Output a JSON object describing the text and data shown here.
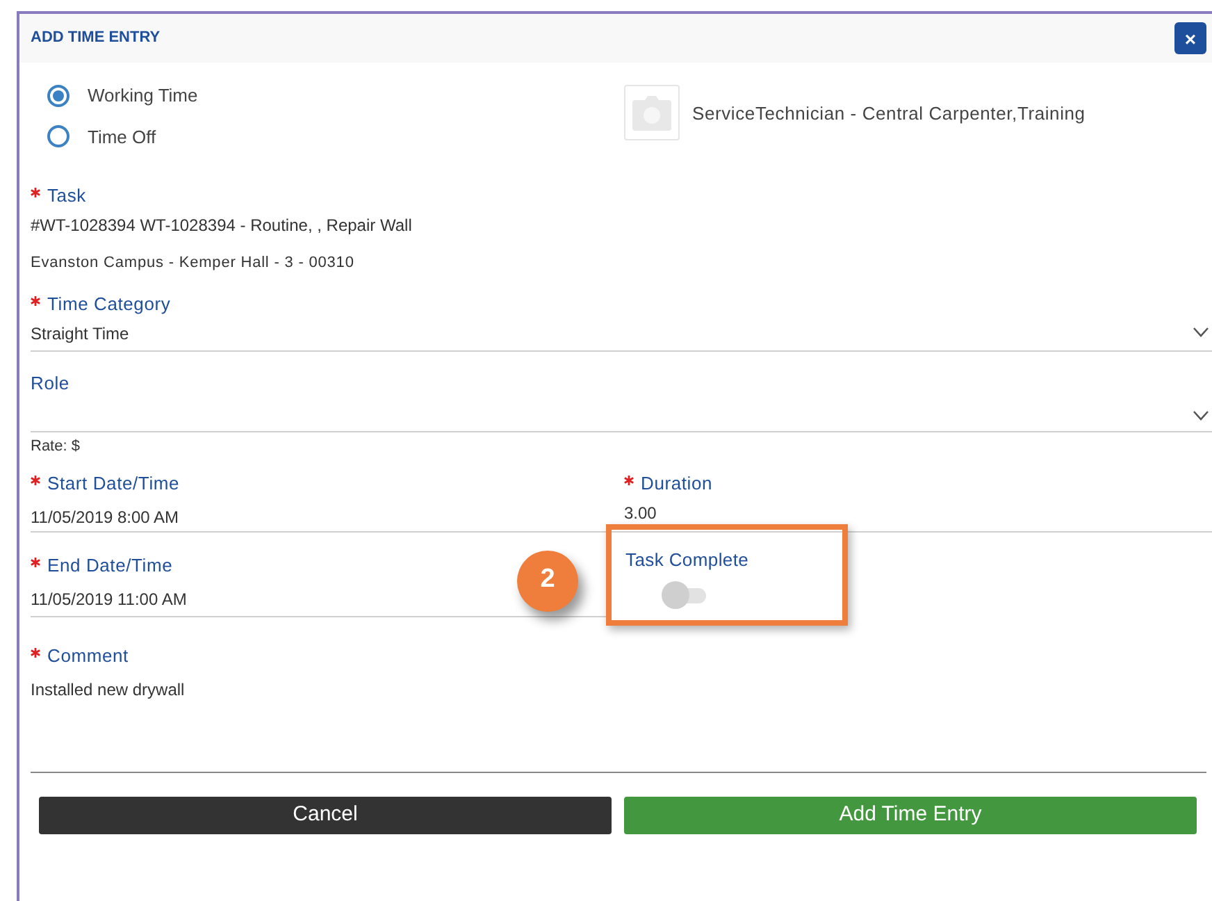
{
  "dialog": {
    "title": "ADD TIME ENTRY",
    "close": "×"
  },
  "entry_type": [
    {
      "label": "Working Time",
      "selected": true
    },
    {
      "label": "Time Off",
      "selected": false
    }
  ],
  "employee": {
    "name": "ServiceTechnician - Central Carpenter,Training"
  },
  "task": {
    "label": "Task",
    "required": true,
    "value": "#WT-1028394 WT-1028394 - Routine, , Repair Wall",
    "location": "Evanston Campus - Kemper Hall - 3 - 00310"
  },
  "time_category": {
    "label": "Time Category",
    "required": true,
    "value": "Straight Time"
  },
  "role": {
    "label": "Role",
    "required": false,
    "rate": "Rate: $"
  },
  "start": {
    "label": "Start Date/Time",
    "required": true,
    "value": "11/05/2019 8:00 AM"
  },
  "duration": {
    "label": "Duration",
    "required": true,
    "value": "3.00"
  },
  "end": {
    "label": "End Date/Time",
    "required": true,
    "value": "11/05/2019 11:00 AM"
  },
  "task_complete": {
    "label": "Task Complete",
    "on": false
  },
  "annotation": {
    "number": "2"
  },
  "comment": {
    "label": "Comment",
    "required": true,
    "value": "Installed new drywall"
  },
  "buttons": [
    {
      "label": "Cancel",
      "kind": "secondary"
    },
    {
      "label": "Add Time Entry",
      "kind": "primary"
    }
  ]
}
